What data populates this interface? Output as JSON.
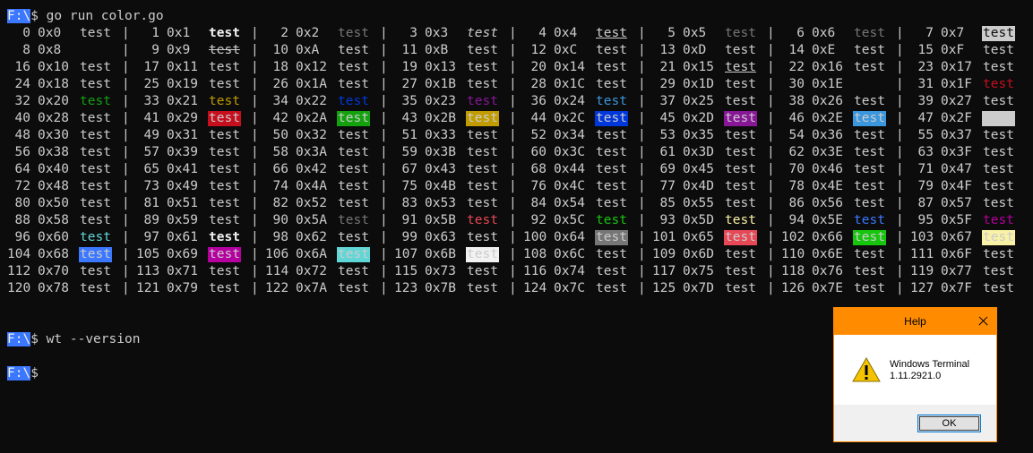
{
  "prompt": {
    "drive": "F:\\",
    "symbol": "$"
  },
  "command1": "go run color.go",
  "command2": "wt --version",
  "separator": "|",
  "rows": [
    [
      [
        "0",
        "0x0",
        "test",
        ""
      ],
      [
        "1",
        "0x1",
        "test",
        "b"
      ],
      [
        "2",
        "0x2",
        "test",
        "dim"
      ],
      [
        "3",
        "0x3",
        "test",
        "i"
      ],
      [
        "4",
        "0x4",
        "test",
        "u"
      ],
      [
        "5",
        "0x5",
        "test",
        "dim"
      ],
      [
        "6",
        "0x6",
        "test",
        "dim"
      ],
      [
        "7",
        "0x7",
        "test",
        "rev"
      ]
    ],
    [
      [
        "8",
        "0x8",
        "",
        ""
      ],
      [
        "9",
        "0x9",
        "test",
        "s"
      ],
      [
        "10",
        "0xA",
        "test",
        ""
      ],
      [
        "11",
        "0xB",
        "test",
        ""
      ],
      [
        "12",
        "0xC",
        "test",
        ""
      ],
      [
        "13",
        "0xD",
        "test",
        ""
      ],
      [
        "14",
        "0xE",
        "test",
        ""
      ],
      [
        "15",
        "0xF",
        "test",
        ""
      ]
    ],
    [
      [
        "16",
        "0x10",
        "test",
        ""
      ],
      [
        "17",
        "0x11",
        "test",
        ""
      ],
      [
        "18",
        "0x12",
        "test",
        ""
      ],
      [
        "19",
        "0x13",
        "test",
        ""
      ],
      [
        "20",
        "0x14",
        "test",
        ""
      ],
      [
        "21",
        "0x15",
        "test",
        "u"
      ],
      [
        "22",
        "0x16",
        "test",
        ""
      ],
      [
        "23",
        "0x17",
        "test",
        ""
      ]
    ],
    [
      [
        "24",
        "0x18",
        "test",
        ""
      ],
      [
        "25",
        "0x19",
        "test",
        ""
      ],
      [
        "26",
        "0x1A",
        "test",
        ""
      ],
      [
        "27",
        "0x1B",
        "test",
        ""
      ],
      [
        "28",
        "0x1C",
        "test",
        ""
      ],
      [
        "29",
        "0x1D",
        "test",
        ""
      ],
      [
        "30",
        "0x1E",
        "",
        ""
      ],
      [
        "31",
        "0x1F",
        "test",
        "fg-red"
      ]
    ],
    [
      [
        "32",
        "0x20",
        "test",
        "fg-green"
      ],
      [
        "33",
        "0x21",
        "test",
        "fg-yellow"
      ],
      [
        "34",
        "0x22",
        "test",
        "fg-blue"
      ],
      [
        "35",
        "0x23",
        "test",
        "fg-magenta"
      ],
      [
        "36",
        "0x24",
        "test",
        "fg-cyan"
      ],
      [
        "37",
        "0x25",
        "test",
        ""
      ],
      [
        "38",
        "0x26",
        "test",
        ""
      ],
      [
        "39",
        "0x27",
        "test",
        ""
      ]
    ],
    [
      [
        "40",
        "0x28",
        "test",
        ""
      ],
      [
        "41",
        "0x29",
        "test",
        "bg-red"
      ],
      [
        "42",
        "0x2A",
        "test",
        "bg-green"
      ],
      [
        "43",
        "0x2B",
        "test",
        "bg-yellow"
      ],
      [
        "44",
        "0x2C",
        "test",
        "bg-blue"
      ],
      [
        "45",
        "0x2D",
        "test",
        "bg-magenta"
      ],
      [
        "46",
        "0x2E",
        "test",
        "bg-cyan"
      ],
      [
        "47",
        "0x2F",
        "test",
        "bg-white"
      ]
    ],
    [
      [
        "48",
        "0x30",
        "test",
        ""
      ],
      [
        "49",
        "0x31",
        "test",
        ""
      ],
      [
        "50",
        "0x32",
        "test",
        ""
      ],
      [
        "51",
        "0x33",
        "test",
        ""
      ],
      [
        "52",
        "0x34",
        "test",
        ""
      ],
      [
        "53",
        "0x35",
        "test",
        ""
      ],
      [
        "54",
        "0x36",
        "test",
        ""
      ],
      [
        "55",
        "0x37",
        "test",
        ""
      ]
    ],
    [
      [
        "56",
        "0x38",
        "test",
        ""
      ],
      [
        "57",
        "0x39",
        "test",
        ""
      ],
      [
        "58",
        "0x3A",
        "test",
        ""
      ],
      [
        "59",
        "0x3B",
        "test",
        ""
      ],
      [
        "60",
        "0x3C",
        "test",
        ""
      ],
      [
        "61",
        "0x3D",
        "test",
        ""
      ],
      [
        "62",
        "0x3E",
        "test",
        ""
      ],
      [
        "63",
        "0x3F",
        "test",
        ""
      ]
    ],
    [
      [
        "64",
        "0x40",
        "test",
        ""
      ],
      [
        "65",
        "0x41",
        "test",
        ""
      ],
      [
        "66",
        "0x42",
        "test",
        ""
      ],
      [
        "67",
        "0x43",
        "test",
        ""
      ],
      [
        "68",
        "0x44",
        "test",
        ""
      ],
      [
        "69",
        "0x45",
        "test",
        ""
      ],
      [
        "70",
        "0x46",
        "test",
        ""
      ],
      [
        "71",
        "0x47",
        "test",
        ""
      ]
    ],
    [
      [
        "72",
        "0x48",
        "test",
        ""
      ],
      [
        "73",
        "0x49",
        "test",
        ""
      ],
      [
        "74",
        "0x4A",
        "test",
        ""
      ],
      [
        "75",
        "0x4B",
        "test",
        ""
      ],
      [
        "76",
        "0x4C",
        "test",
        ""
      ],
      [
        "77",
        "0x4D",
        "test",
        ""
      ],
      [
        "78",
        "0x4E",
        "test",
        ""
      ],
      [
        "79",
        "0x4F",
        "test",
        ""
      ]
    ],
    [
      [
        "80",
        "0x50",
        "test",
        ""
      ],
      [
        "81",
        "0x51",
        "test",
        ""
      ],
      [
        "82",
        "0x52",
        "test",
        ""
      ],
      [
        "83",
        "0x53",
        "test",
        ""
      ],
      [
        "84",
        "0x54",
        "test",
        ""
      ],
      [
        "85",
        "0x55",
        "test",
        ""
      ],
      [
        "86",
        "0x56",
        "test",
        ""
      ],
      [
        "87",
        "0x57",
        "test",
        ""
      ]
    ],
    [
      [
        "88",
        "0x58",
        "test",
        ""
      ],
      [
        "89",
        "0x59",
        "test",
        ""
      ],
      [
        "90",
        "0x5A",
        "test",
        "dim"
      ],
      [
        "91",
        "0x5B",
        "test",
        "fg-bred"
      ],
      [
        "92",
        "0x5C",
        "test",
        "fg-bgreen"
      ],
      [
        "93",
        "0x5D",
        "test",
        "fg-byellow"
      ],
      [
        "94",
        "0x5E",
        "test",
        "fg-bblue"
      ],
      [
        "95",
        "0x5F",
        "test",
        "fg-bmagenta"
      ]
    ],
    [
      [
        "96",
        "0x60",
        "test",
        "fg-bcyan"
      ],
      [
        "97",
        "0x61",
        "test",
        "b"
      ],
      [
        "98",
        "0x62",
        "test",
        ""
      ],
      [
        "99",
        "0x63",
        "test",
        ""
      ],
      [
        "100",
        "0x64",
        "test",
        "bg-gray"
      ],
      [
        "101",
        "0x65",
        "test",
        "bg-bred"
      ],
      [
        "102",
        "0x66",
        "test",
        "bg-bgreen"
      ],
      [
        "103",
        "0x67",
        "test",
        "bg-byellow"
      ]
    ],
    [
      [
        "104",
        "0x68",
        "test",
        "bg-bblue"
      ],
      [
        "105",
        "0x69",
        "test",
        "bg-bmagenta"
      ],
      [
        "106",
        "0x6A",
        "test",
        "bg-bcyan"
      ],
      [
        "107",
        "0x6B",
        "test",
        "bg-bwhite"
      ],
      [
        "108",
        "0x6C",
        "test",
        ""
      ],
      [
        "109",
        "0x6D",
        "test",
        ""
      ],
      [
        "110",
        "0x6E",
        "test",
        ""
      ],
      [
        "111",
        "0x6F",
        "test",
        ""
      ]
    ],
    [
      [
        "112",
        "0x70",
        "test",
        ""
      ],
      [
        "113",
        "0x71",
        "test",
        ""
      ],
      [
        "114",
        "0x72",
        "test",
        ""
      ],
      [
        "115",
        "0x73",
        "test",
        ""
      ],
      [
        "116",
        "0x74",
        "test",
        ""
      ],
      [
        "117",
        "0x75",
        "test",
        ""
      ],
      [
        "118",
        "0x76",
        "test",
        ""
      ],
      [
        "119",
        "0x77",
        "test",
        ""
      ]
    ],
    [
      [
        "120",
        "0x78",
        "test",
        ""
      ],
      [
        "121",
        "0x79",
        "test",
        ""
      ],
      [
        "122",
        "0x7A",
        "test",
        ""
      ],
      [
        "123",
        "0x7B",
        "test",
        ""
      ],
      [
        "124",
        "0x7C",
        "test",
        ""
      ],
      [
        "125",
        "0x7D",
        "test",
        ""
      ],
      [
        "126",
        "0x7E",
        "test",
        ""
      ],
      [
        "127",
        "0x7F",
        "test",
        ""
      ]
    ]
  ],
  "dialog": {
    "title": "Help",
    "close_icon": "close-icon",
    "warning_icon": "warning-icon",
    "app_name": "Windows Terminal",
    "version": "1.11.2921.0",
    "ok_label": "OK"
  },
  "colors": {
    "background": "#0c0c0c",
    "foreground": "#cccccc",
    "prompt_bg": "#3b78ff",
    "dialog_accent": "#ff8c00"
  }
}
